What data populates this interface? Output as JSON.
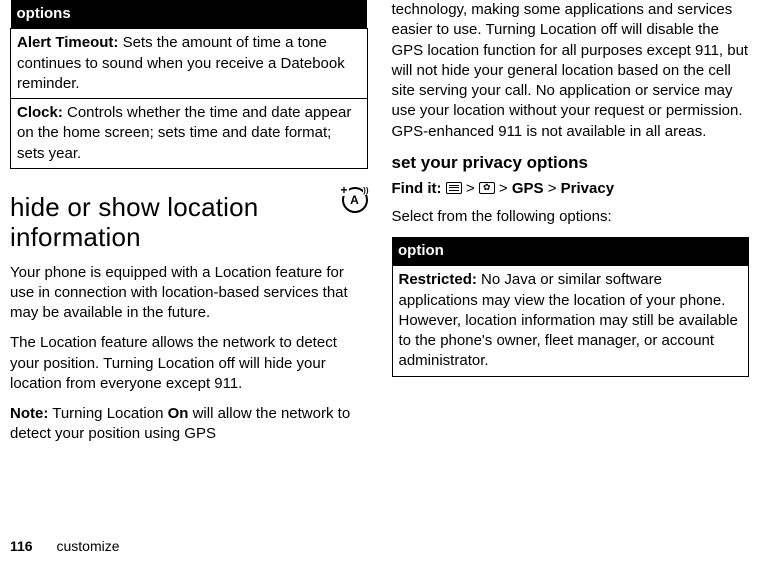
{
  "left": {
    "table_header": "options",
    "row1_label": "Alert Timeout:",
    "row1_text": " Sets the amount of time a tone continues to sound when you receive a Datebook reminder.",
    "row2_label": "Clock:",
    "row2_text": " Controls whether the time and date appear on the home screen; sets time and date format; sets year.",
    "section_heading": "hide or show location information",
    "icon_letter": "A",
    "p1": "Your phone is equipped with a Location feature for use in connection with location-based services that may be available in the future.",
    "p2": "The Location feature allows the network to detect your position. Turning Location off will hide your location from everyone except 911.",
    "p3_label": "Note:",
    "p3_text_a": " Turning Location ",
    "p3_on": "On",
    "p3_text_b": " will allow the network to detect your position using GPS"
  },
  "right": {
    "p_cont": "technology, making some applications and services easier to use. Turning Location off will disable the GPS location function for all purposes except 911, but will not hide your general location based on the cell site serving your call. No application or service may use your location without your request or permission. GPS-enhanced 911 is not available in all areas.",
    "sub_heading": "set your privacy options",
    "findit_label": "Find it:",
    "gt1": " > ",
    "gt2": " > ",
    "gps": "GPS",
    "gt3": " > ",
    "privacy": "Privacy",
    "select_text": "Select from the following options:",
    "table_header": "option",
    "row1_label": "Restricted:",
    "row1_text": " No Java or similar software applications may view the location of your phone. However, location information may still be available to the phone's owner, fleet manager, or account administrator."
  },
  "footer": {
    "page": "116",
    "section": "customize"
  }
}
